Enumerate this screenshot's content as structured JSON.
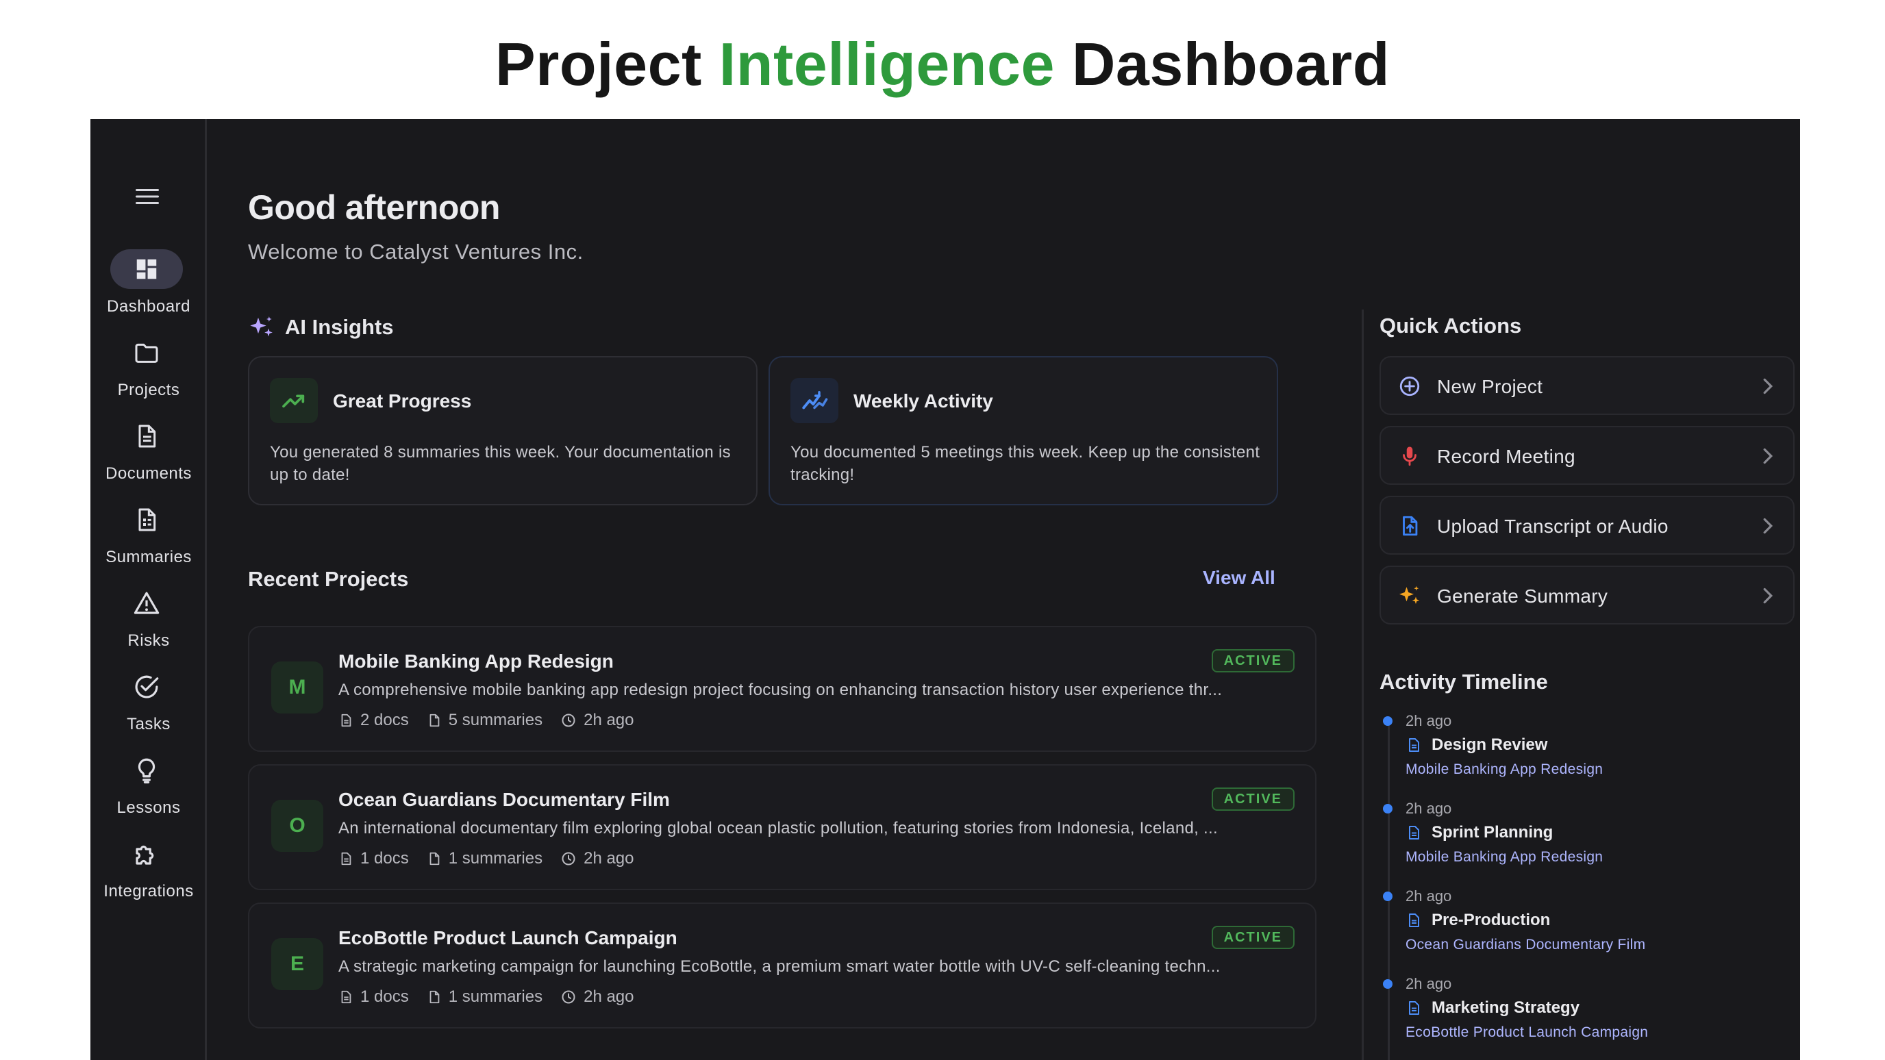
{
  "headline": {
    "part1": "Project ",
    "part2": "Intelligence",
    "part3": " Dashboard"
  },
  "colors": {
    "accent_green": "#2e9a3c",
    "app_bg": "#19191c",
    "link": "#a9b4ff",
    "status_green": "#52b85c",
    "timeline_dot": "#3b82f6"
  },
  "sidebar": {
    "menu_icon": "hamburger-icon",
    "items": [
      {
        "label": "Dashboard",
        "icon": "dashboard-icon",
        "active": true
      },
      {
        "label": "Projects",
        "icon": "folder-icon"
      },
      {
        "label": "Documents",
        "icon": "document-icon"
      },
      {
        "label": "Summaries",
        "icon": "summary-icon"
      },
      {
        "label": "Risks",
        "icon": "warning-icon"
      },
      {
        "label": "Tasks",
        "icon": "check-circle-icon"
      },
      {
        "label": "Lessons",
        "icon": "lightbulb-icon"
      },
      {
        "label": "Integrations",
        "icon": "puzzle-icon"
      }
    ]
  },
  "main": {
    "greeting": "Good afternoon",
    "welcome": "Welcome to Catalyst Ventures Inc.",
    "ai_insights": {
      "title": "AI Insights",
      "cards": [
        {
          "title": "Great Progress",
          "description": "You generated 8 summaries this week. Your documentation is up to date!",
          "icon": "trending-up-icon"
        },
        {
          "title": "Weekly Activity",
          "description": "You documented 5 meetings this week. Keep up the consistent tracking!",
          "icon": "activity-chart-icon"
        }
      ]
    },
    "recent_projects": {
      "title": "Recent Projects",
      "view_all": "View All",
      "items": [
        {
          "initial": "M",
          "title": "Mobile Banking App Redesign",
          "status": "ACTIVE",
          "description": "A comprehensive mobile banking app redesign project focusing on enhancing transaction history user experience thr...",
          "docs": "2 docs",
          "summaries": "5 summaries",
          "time": "2h ago"
        },
        {
          "initial": "O",
          "title": "Ocean Guardians Documentary Film",
          "status": "ACTIVE",
          "description": "An international documentary film exploring global ocean plastic pollution, featuring stories from Indonesia, Iceland, ...",
          "docs": "1 docs",
          "summaries": "1 summaries",
          "time": "2h ago"
        },
        {
          "initial": "E",
          "title": "EcoBottle Product Launch Campaign",
          "status": "ACTIVE",
          "description": "A strategic marketing campaign for launching EcoBottle, a premium smart water bottle with UV-C self-cleaning techn...",
          "docs": "1 docs",
          "summaries": "1 summaries",
          "time": "2h ago"
        }
      ]
    }
  },
  "quick_actions": {
    "title": "Quick Actions",
    "items": [
      {
        "label": "New Project",
        "icon": "plus-circle-icon"
      },
      {
        "label": "Record Meeting",
        "icon": "microphone-icon"
      },
      {
        "label": "Upload Transcript or Audio",
        "icon": "upload-file-icon"
      },
      {
        "label": "Generate Summary",
        "icon": "sparkle-icon"
      }
    ]
  },
  "activity_timeline": {
    "title": "Activity Timeline",
    "items": [
      {
        "time": "2h ago",
        "title": "Design Review",
        "project": "Mobile Banking App Redesign"
      },
      {
        "time": "2h ago",
        "title": "Sprint Planning",
        "project": "Mobile Banking App Redesign"
      },
      {
        "time": "2h ago",
        "title": "Pre-Production",
        "project": "Ocean Guardians Documentary Film"
      },
      {
        "time": "2h ago",
        "title": "Marketing Strategy",
        "project": "EcoBottle Product Launch Campaign"
      }
    ]
  }
}
